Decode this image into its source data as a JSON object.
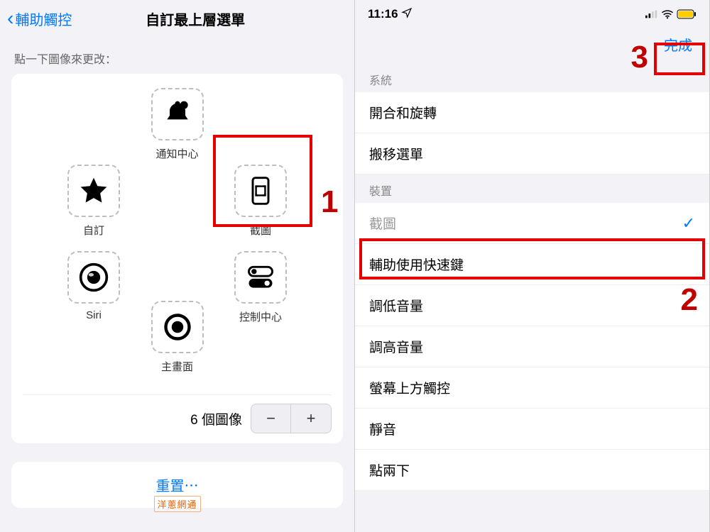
{
  "left": {
    "back_label": "輔助觸控",
    "title": "自訂最上層選單",
    "subhead": "點一下圖像來更改：",
    "slots": {
      "top": {
        "label": "通知中心"
      },
      "tl": {
        "label": "自訂"
      },
      "tr": {
        "label": "截圖"
      },
      "bl": {
        "label": "Siri"
      },
      "br": {
        "label": "控制中心"
      },
      "bot": {
        "label": "主畫面"
      }
    },
    "counter_label": "6 個圖像",
    "reset_label": "重置⋯"
  },
  "right": {
    "status_time": "11:16",
    "done_label": "完成",
    "section1_header": "系統",
    "rows1": [
      "開合和旋轉",
      "搬移選單"
    ],
    "section2_header": "裝置",
    "rows2_selected": "截圖",
    "rows2_rest": [
      "輔助使用快速鍵",
      "調低音量",
      "調高音量",
      "螢幕上方觸控",
      "靜音",
      "點兩下"
    ]
  },
  "annotations": {
    "n1": "1",
    "n2": "2",
    "n3": "3"
  },
  "watermark": "洋蔥網通"
}
